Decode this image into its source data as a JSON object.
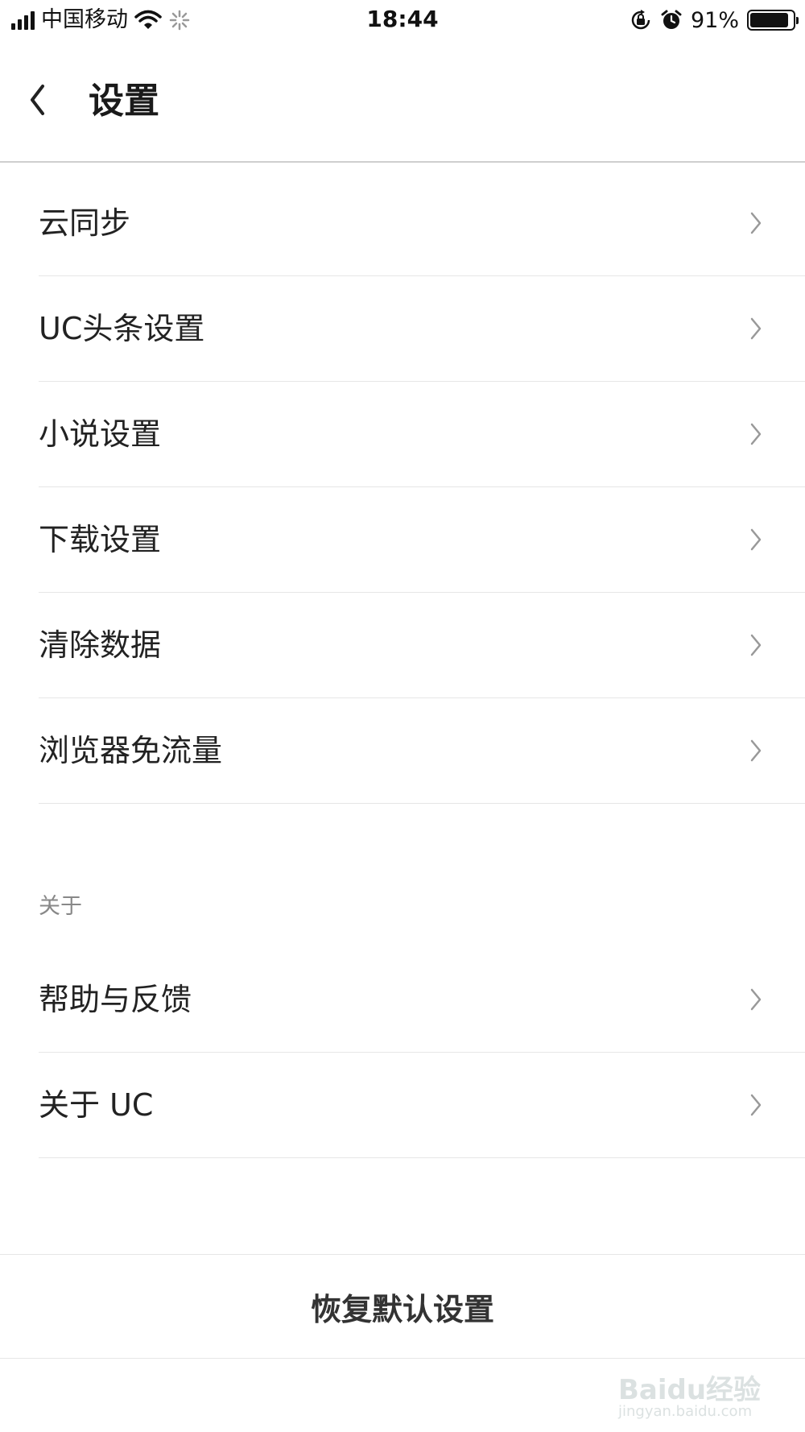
{
  "status_bar": {
    "carrier": "中国移动",
    "time": "18:44",
    "battery_percent": "91%",
    "battery_level": 0.91,
    "icons": [
      "signal-icon",
      "wifi-icon",
      "loading-spinner-icon",
      "orientation-lock-icon",
      "alarm-icon",
      "battery-icon"
    ]
  },
  "header": {
    "title": "设置",
    "back_icon": "chevron-left-icon"
  },
  "settings_list": {
    "items": [
      {
        "label": "云同步"
      },
      {
        "label": "UC头条设置"
      },
      {
        "label": "小说设置"
      },
      {
        "label": "下载设置"
      },
      {
        "label": "清除数据"
      },
      {
        "label": "浏览器免流量"
      }
    ]
  },
  "about_section": {
    "heading": "关于",
    "items": [
      {
        "label": "帮助与反馈"
      },
      {
        "label": "关于 UC"
      }
    ]
  },
  "footer": {
    "reset_label": "恢复默认设置"
  },
  "watermark": {
    "text": "Baidu经验",
    "sub": "jingyan.baidu.com"
  },
  "colors": {
    "background": "#ffffff",
    "text_primary": "#222222",
    "text_secondary": "#888888",
    "divider": "#e6e6e6",
    "chevron": "#999999"
  }
}
